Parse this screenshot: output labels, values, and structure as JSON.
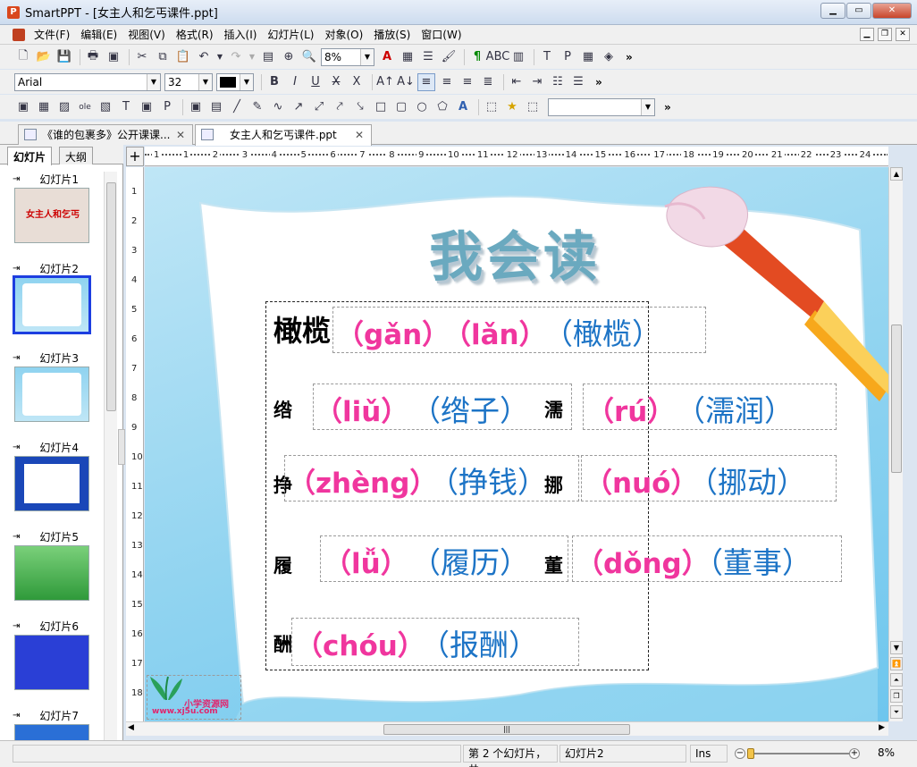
{
  "window": {
    "title": "SmartPPT - [女主人和乞丐课件.ppt]",
    "app_icon": "smartppt-icon"
  },
  "menu": {
    "items": [
      "文件(F)",
      "编辑(E)",
      "视图(V)",
      "格式(R)",
      "插入(I)",
      "幻灯片(L)",
      "对象(O)",
      "播放(S)",
      "窗口(W)"
    ]
  },
  "toolbar1": {
    "zoom_value": "8%"
  },
  "toolbar2": {
    "font_name": "Arial",
    "font_size": "32",
    "font_color": "#000000"
  },
  "doc_tabs": [
    {
      "label": "《谁的包裹多》公开课课...",
      "active": false
    },
    {
      "label": "女主人和乞丐课件.ppt",
      "active": true
    }
  ],
  "left_panel": {
    "tabs": [
      "幻灯片",
      "大纲"
    ],
    "slides": [
      {
        "label": "幻灯片1",
        "selected": false
      },
      {
        "label": "幻灯片2",
        "selected": true
      },
      {
        "label": "幻灯片3",
        "selected": false
      },
      {
        "label": "幻灯片4",
        "selected": false
      },
      {
        "label": "幻灯片5",
        "selected": false
      },
      {
        "label": "幻灯片6",
        "selected": false
      },
      {
        "label": "幻灯片7",
        "selected": false
      }
    ],
    "thumb1_title": "女主人和乞丐"
  },
  "slide": {
    "title": "我会读",
    "head_word": "橄榄",
    "head_pinyin1": "（gǎn）",
    "head_pinyin2": "（lǎn）",
    "head_cn": "（橄榄）",
    "rows": [
      {
        "char": "绺",
        "pinyin": "（liǔ）",
        "word": "（绺子）"
      },
      {
        "char": "濡",
        "pinyin": "（rú）",
        "word": "（濡润）"
      },
      {
        "char": "挣",
        "pinyin": "（zhèng）",
        "word": "（挣钱）"
      },
      {
        "char": "挪",
        "pinyin": "（nuó）",
        "word": "（挪动）"
      },
      {
        "char": "履",
        "pinyin": "（lǚ）",
        "word": "（履历）"
      },
      {
        "char": "董",
        "pinyin": "（dǒng）",
        "word": "（董事）"
      },
      {
        "char": "酬",
        "pinyin": "（chóu）",
        "word": "（报酬）"
      }
    ],
    "logo_text": "小学资源网",
    "logo_url": "www.xj5u.com",
    "pinyin_color": "#f0369e",
    "word_color": "#1d74c6"
  },
  "ruler": {
    "h_ticks": [
      "1",
      "1",
      "2",
      "3",
      "4",
      "5",
      "6",
      "7",
      "8",
      "9",
      "10",
      "11",
      "12",
      "13",
      "14",
      "15",
      "16",
      "17",
      "18",
      "19",
      "20",
      "21",
      "22",
      "23",
      "24",
      "25"
    ],
    "v_ticks": [
      "1",
      "2",
      "3",
      "4",
      "5",
      "6",
      "7",
      "8",
      "9",
      "10",
      "11",
      "12",
      "13",
      "14",
      "15",
      "16",
      "17",
      "18"
    ]
  },
  "status": {
    "slide_info": "第 2 个幻灯片，共",
    "slide_name": "幻灯片2",
    "mode": "Ins",
    "zoom": "8%"
  }
}
